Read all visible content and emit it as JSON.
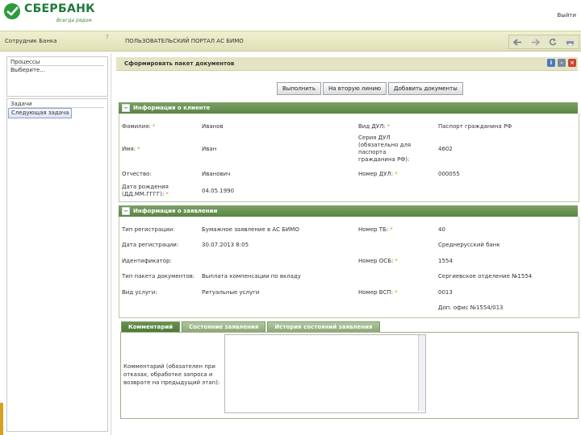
{
  "header": {
    "brand": "СБЕРБАНК",
    "slogan": "Всегда рядом",
    "exit": "Выйти"
  },
  "topbar": {
    "employee_title": "Сотрудник Банка",
    "help_mark": "?",
    "portal_title": "ПОЛЬЗОВАТЕЛЬСКИЙ ПОРТАЛ АС БИМО",
    "icons": [
      "back-icon",
      "forward-icon",
      "refresh-icon",
      "print-icon"
    ]
  },
  "left_panel": {
    "processes_label": "Процессы",
    "processes_item": "Выберите...",
    "task_label": "Задачи",
    "next_task_button": "Следующая задача"
  },
  "main": {
    "title": "Сформировать пакет документов",
    "title_icons": [
      "info-icon",
      "minimize-icon",
      "close-icon"
    ],
    "actions": [
      "Выполнить",
      "На вторую линию",
      "Добавить документы"
    ]
  },
  "client_section": {
    "title": "Информация о клиенте",
    "left": [
      {
        "label": "Фамилия:",
        "required": true,
        "value": "Иванов"
      },
      {
        "label": "Имя:",
        "required": true,
        "value": "Иван"
      },
      {
        "label": "Отчество:",
        "required": false,
        "value": "Иванович"
      },
      {
        "label": "Дата рождения (ДД.ММ.ГГГГ):",
        "required": true,
        "value": "04.05.1990"
      }
    ],
    "right": [
      {
        "label": "Вид ДУЛ:",
        "required": true,
        "value": "Паспорт гражданина РФ"
      },
      {
        "label": "Серия ДУЛ (обязательно для паспорта гражданина РФ):",
        "required": false,
        "value": "4602"
      },
      {
        "label": "Номер ДУЛ:",
        "required": true,
        "value": "000055"
      }
    ]
  },
  "application_section": {
    "title": "Информация о заявлении",
    "left": [
      {
        "label": "Тип регистрации:",
        "required": false,
        "value": "Бумажное заявление в АС БИМО"
      },
      {
        "label": "Дата регистрации:",
        "required": false,
        "value": "30.07.2013 8:05"
      },
      {
        "label": "Идентификатор:",
        "required": false,
        "value": ""
      },
      {
        "label": "Тип пакета документов:",
        "required": false,
        "value": "Выплата компенсации по вкладу"
      },
      {
        "label": "Вид услуги:",
        "required": false,
        "value": "Ритуальные услуги"
      }
    ],
    "right": [
      {
        "label": "Номер ТБ:",
        "required": true,
        "value": "40"
      },
      {
        "label": "",
        "required": false,
        "value": "Среднерусский банк"
      },
      {
        "label": "Номер ОСБ:",
        "required": true,
        "value": "1554"
      },
      {
        "label": "",
        "required": false,
        "value": "Сергиевское отделение №1554"
      },
      {
        "label": "Номер ВСП:",
        "required": true,
        "value": "0013"
      },
      {
        "label": "",
        "required": false,
        "value": "Доп. офис №1554/013"
      }
    ]
  },
  "bottom_tabs": [
    "Комментарий",
    "Состояние заявления",
    "История состояний заявления"
  ],
  "comment": {
    "label": "Комментарий (обязателен при отказах, обработке запроса и возврате на предыдущий этап):",
    "value": ""
  },
  "colors": {
    "brand_green": "#1f7a3a",
    "section_green": "#5a8544",
    "required_mark": "#e08a00"
  }
}
